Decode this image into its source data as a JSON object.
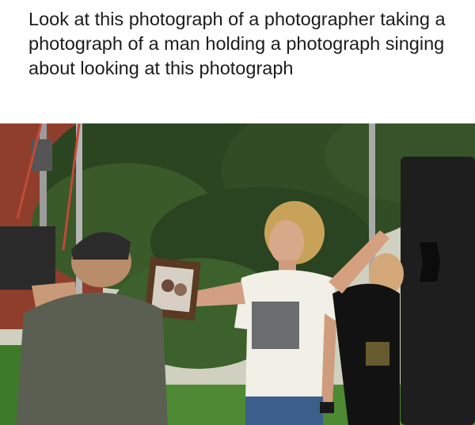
{
  "post": {
    "caption": "Look at this photograph of a photographer taking a photograph of a man holding a photograph singing about looking at this photograph"
  },
  "photo": {
    "description_icons": [
      "photographer",
      "singer",
      "framed-photograph",
      "light-stand",
      "crew-member",
      "reflector-panel"
    ],
    "colors": {
      "sky": "#d6d6c8",
      "foliage": "#2f4a24",
      "grass": "#4d8a33",
      "photographer_shirt": "#5b5f52",
      "singer_shirt": "#f1efe6",
      "crew_shirt": "#121212",
      "panel": "#1e1e1e"
    }
  }
}
